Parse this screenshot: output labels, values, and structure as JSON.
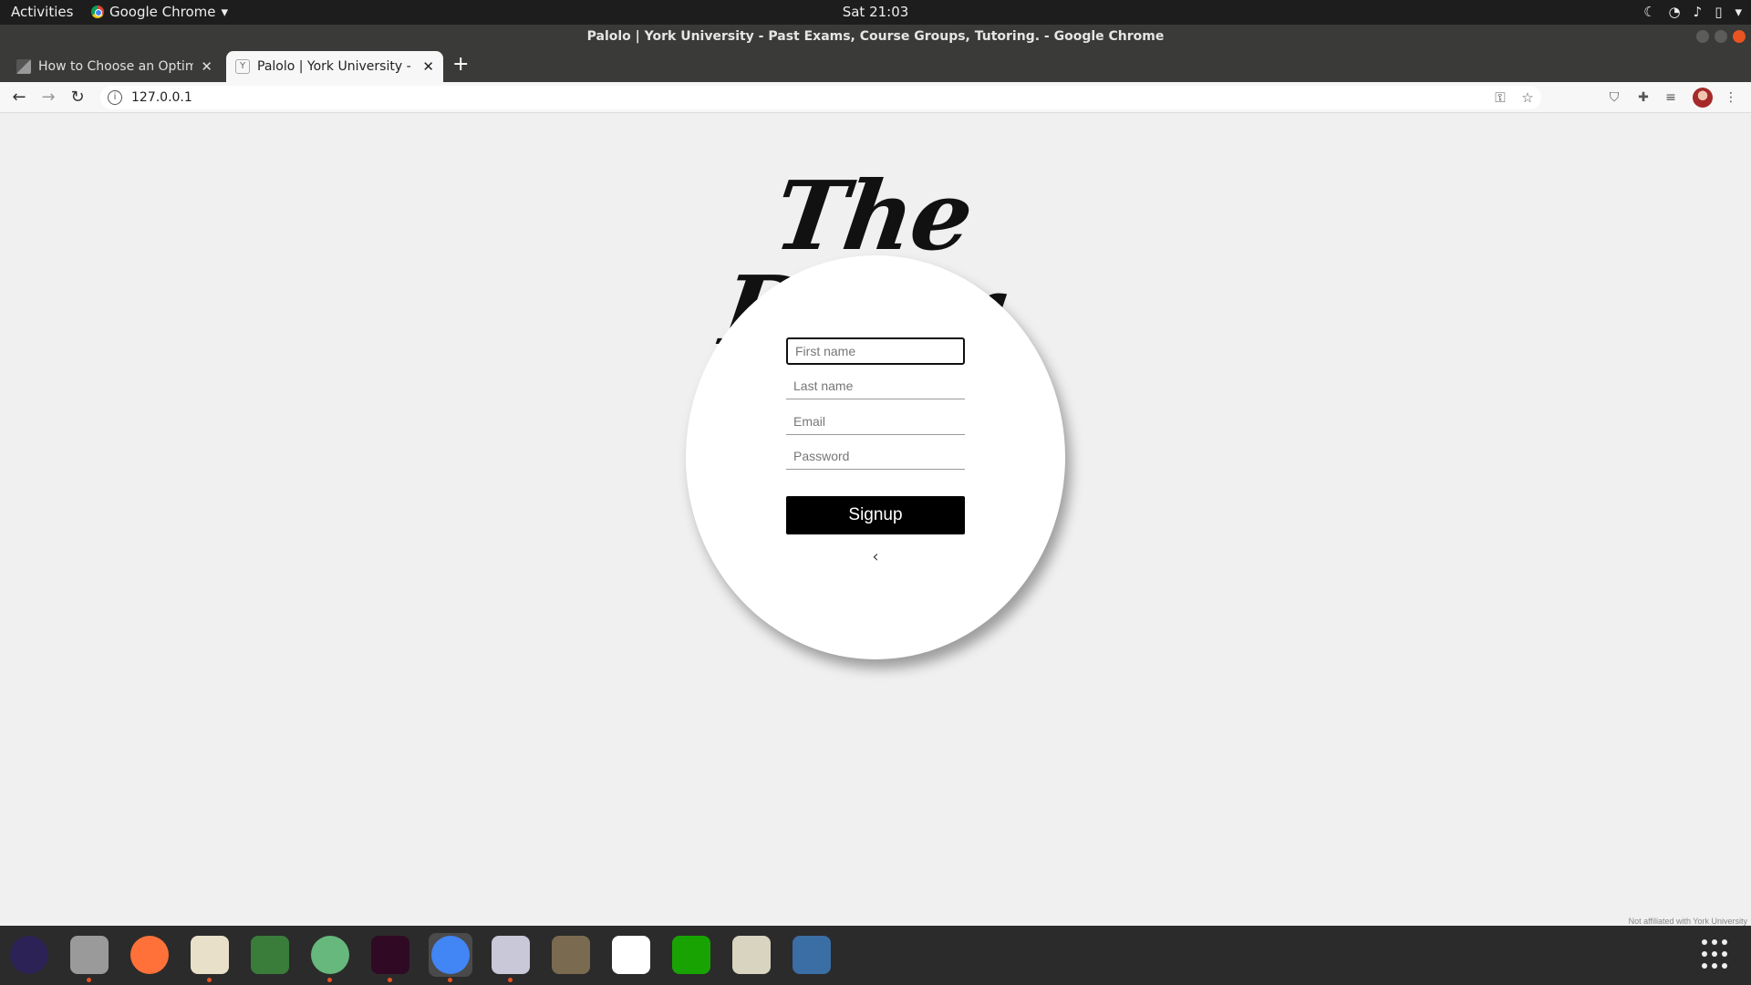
{
  "topbar": {
    "activities": "Activities",
    "app_name": "Google Chrome",
    "clock": "Sat 21:03"
  },
  "window": {
    "title": "Palolo | York University - Past Exams, Course Groups, Tutoring. - Google Chrome"
  },
  "tabs": [
    {
      "title": "How to Choose an Optim",
      "active": false,
      "favicon": "article-favicon"
    },
    {
      "title": "Palolo | York University - P",
      "active": true,
      "favicon": "palolo-favicon"
    }
  ],
  "toolbar": {
    "url": "127.0.0.1"
  },
  "page": {
    "logo": "The Diver",
    "form": {
      "first_name_placeholder": "First name",
      "last_name_placeholder": "Last name",
      "email_placeholder": "Email",
      "password_placeholder": "Password",
      "signup_label": "Signup",
      "back_icon": "‹"
    },
    "disclaimer": "Not affiliated with York University"
  },
  "dock": {
    "apps": [
      {
        "name": "eclipse",
        "color": "#2c2255",
        "running": false
      },
      {
        "name": "files",
        "color": "#9a9a9a",
        "running": true
      },
      {
        "name": "firefox",
        "color": "#ff7139",
        "running": false
      },
      {
        "name": "text-editor",
        "color": "#e8e0c8",
        "running": true
      },
      {
        "name": "inkscape",
        "color": "#3a7c3a",
        "running": false
      },
      {
        "name": "atom",
        "color": "#66b87c",
        "running": true
      },
      {
        "name": "terminal",
        "color": "#300a24",
        "running": true
      },
      {
        "name": "chrome",
        "color": "#4285f4",
        "running": true
      },
      {
        "name": "draw",
        "color": "#c8c8d8",
        "running": true
      },
      {
        "name": "gimp",
        "color": "#7a6a50",
        "running": false
      },
      {
        "name": "pdf-viewer",
        "color": "#ffffff",
        "running": false
      },
      {
        "name": "spreadsheet",
        "color": "#18a303",
        "running": false
      },
      {
        "name": "image-viewer",
        "color": "#d8d4c0",
        "running": false
      },
      {
        "name": "screenshot",
        "color": "#3a6ea5",
        "running": false
      }
    ]
  }
}
